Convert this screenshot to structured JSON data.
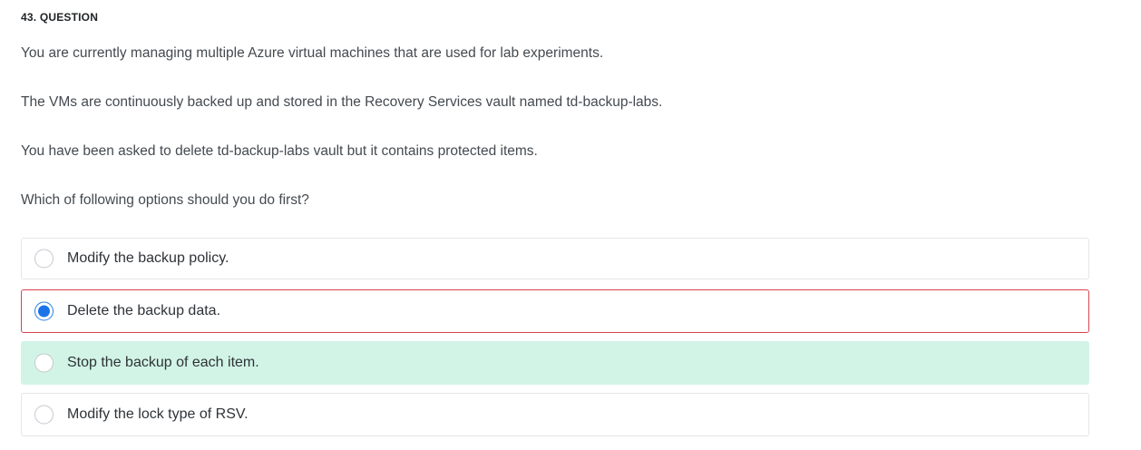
{
  "question": {
    "header": "43. QUESTION",
    "paragraphs": [
      "You are currently managing multiple Azure virtual machines that are used for lab experiments.",
      "The VMs are continuously backed up and stored in the Recovery Services vault named td-backup-labs.",
      "You have been asked to delete td-backup-labs vault but it contains protected items.",
      "Which of following options should you do first?"
    ]
  },
  "options": [
    {
      "label": "Modify the backup policy.",
      "selected": false,
      "state": "neutral"
    },
    {
      "label": "Delete the backup data.",
      "selected": true,
      "state": "incorrect"
    },
    {
      "label": "Stop the backup of each item.",
      "selected": false,
      "state": "correct"
    },
    {
      "label": "Modify the lock type of RSV.",
      "selected": false,
      "state": "neutral"
    }
  ],
  "colors": {
    "incorrect_border": "#d9424f",
    "correct_background": "#d2f4e6",
    "radio_selected": "#1a73e8"
  }
}
